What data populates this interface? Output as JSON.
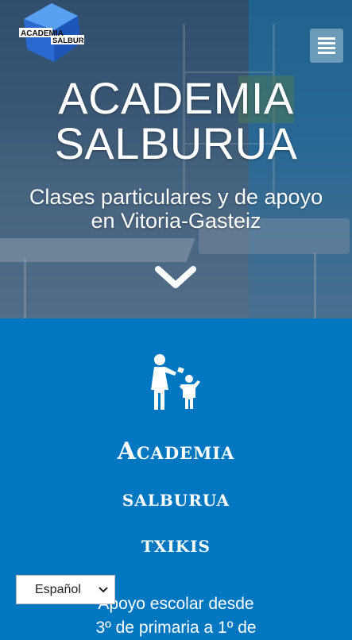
{
  "brand": {
    "logo_text_top": "ACADEMIA",
    "logo_text_bottom": "SALBURUA",
    "logo_color": "#1e6fd6"
  },
  "header": {
    "menu_icon": "hamburger-menu-icon"
  },
  "hero": {
    "title_line1": "ACADEMIA",
    "title_line2": "SALBURUA",
    "subtitle_line1": "Clases particulares y de apoyo",
    "subtitle_line2": "en Vitoria-Gasteiz",
    "scroll_icon": "chevron-down-icon"
  },
  "section": {
    "icon": "adult-child-icon",
    "title_line1": "Academia",
    "title_line2": "salburua",
    "title_line3": "txikis",
    "desc_line1": "Apoyo escolar desde",
    "desc_line2": "3º de primaria a 1º de",
    "background": "#0077c0"
  },
  "language_selector": {
    "selected": "Español"
  }
}
